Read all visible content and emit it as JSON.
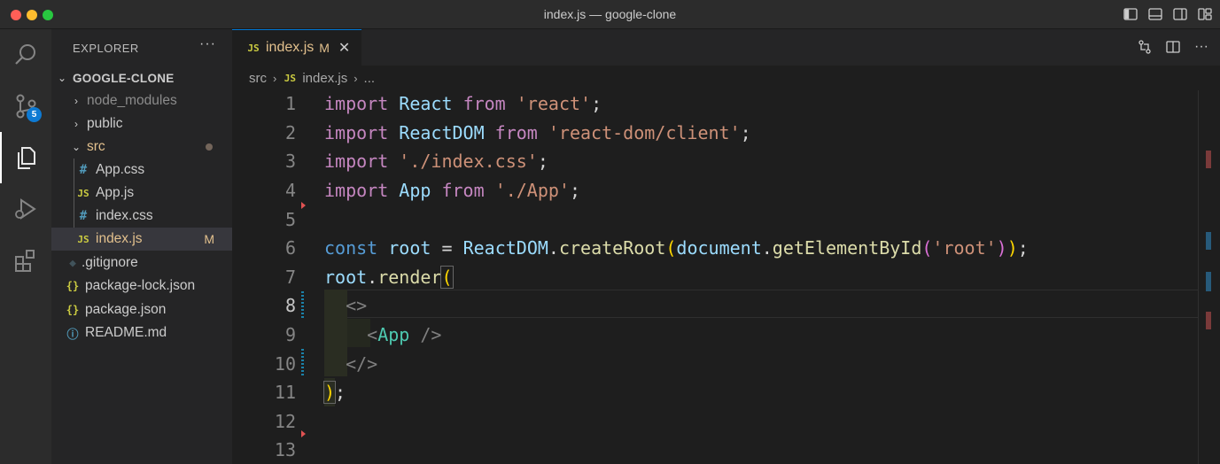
{
  "window": {
    "title": "index.js — google-clone"
  },
  "activity_bar": {
    "items": [
      {
        "name": "search"
      },
      {
        "name": "source-control",
        "badge": "5"
      },
      {
        "name": "explorer"
      },
      {
        "name": "run-debug"
      },
      {
        "name": "extensions"
      }
    ]
  },
  "explorer": {
    "header": "EXPLORER",
    "more": "···",
    "root": "GOOGLE-CLONE",
    "items": [
      {
        "label": "node_modules",
        "kind": "folder"
      },
      {
        "label": "public",
        "kind": "folder"
      },
      {
        "label": "src",
        "kind": "folder"
      },
      {
        "label": "App.css",
        "icon": "#"
      },
      {
        "label": "App.js",
        "icon": "JS"
      },
      {
        "label": "index.css",
        "icon": "#"
      },
      {
        "label": "index.js",
        "icon": "JS",
        "status": "M"
      },
      {
        "label": ".gitignore",
        "icon": "◆"
      },
      {
        "label": "package-lock.json",
        "icon": "{}"
      },
      {
        "label": "package.json",
        "icon": "{}"
      },
      {
        "label": "README.md",
        "icon": "ⓘ"
      }
    ]
  },
  "tab": {
    "icon": "JS",
    "label": "index.js",
    "status": "M",
    "close": "✕"
  },
  "breadcrumbs": {
    "segments": [
      "src",
      "index.js",
      "..."
    ],
    "icon": "JS"
  },
  "editor": {
    "line_numbers": [
      "1",
      "2",
      "3",
      "4",
      "5",
      "6",
      "7",
      "8",
      "9",
      "10",
      "11",
      "12",
      "13"
    ],
    "active_line": "8",
    "tokens": {
      "import": "import",
      "from": "from",
      "const": "const",
      "React": "React",
      "ReactDOM": "ReactDOM",
      "App": "App",
      "s_react": "'react'",
      "s_reactdom": "'react-dom/client'",
      "s_indexcss": "'./index.css'",
      "s_app": "'./App'",
      "s_root": "'root'",
      "root": "root",
      "createRoot": "createRoot",
      "document": "document",
      "getElementById": "getElementById",
      "render": "render"
    }
  },
  "colors": {
    "accent": "#0078d4",
    "modified": "#e2c08d",
    "badge": "#0e7ad3"
  }
}
